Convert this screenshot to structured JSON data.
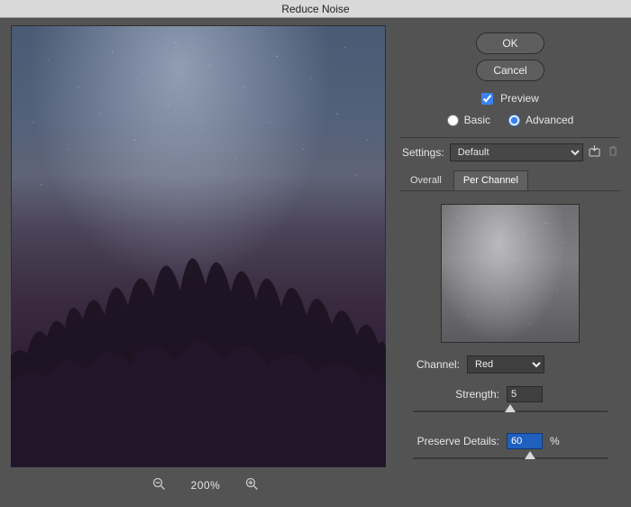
{
  "dialog": {
    "title": "Reduce Noise",
    "ok_label": "OK",
    "cancel_label": "Cancel",
    "preview_label": "Preview",
    "preview_checked": true,
    "mode": {
      "basic_label": "Basic",
      "advanced_label": "Advanced",
      "selected": "advanced"
    },
    "settings_label": "Settings:",
    "settings_preset": "Default",
    "tabs": {
      "overall_label": "Overall",
      "per_channel_label": "Per Channel",
      "active": "per_channel"
    },
    "channel": {
      "label": "Channel:",
      "value": "Red"
    },
    "strength": {
      "label": "Strength:",
      "value": "5",
      "percent": 50
    },
    "preserve_details": {
      "label": "Preserve Details:",
      "value": "60",
      "suffix": "%",
      "percent": 60
    }
  },
  "zoom": {
    "level": "200%"
  },
  "icons": {
    "zoom_out": "zoom-out-icon",
    "zoom_in": "zoom-in-icon",
    "save_preset": "save-preset-icon",
    "delete_preset": "trash-icon"
  }
}
